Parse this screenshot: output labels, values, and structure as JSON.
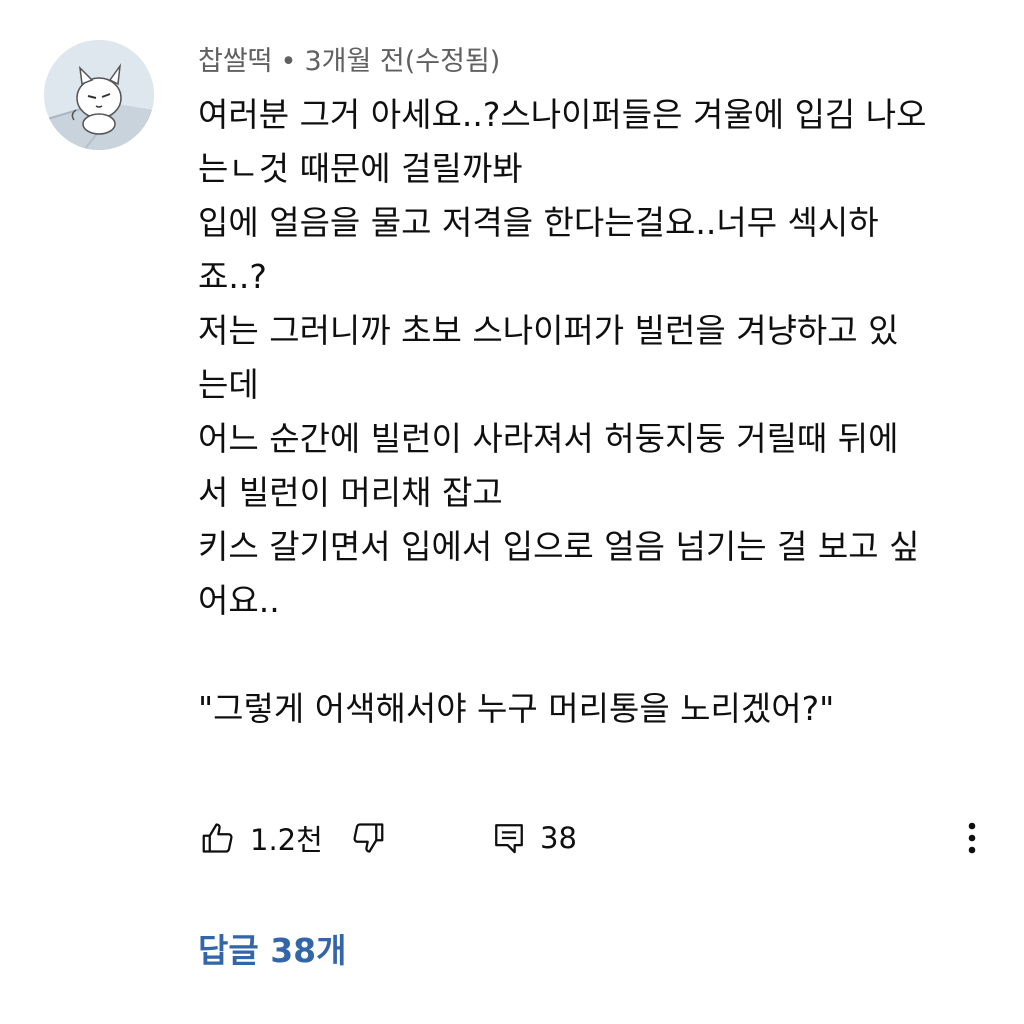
{
  "comment": {
    "author": "찹쌀떡",
    "separator": "•",
    "time": "3개월 전(수정됨)",
    "lines": [
      "여러분 그거 아세요..?스나이퍼들은 겨울에 입김 나오",
      "는ㄴ것 때문에 걸릴까봐",
      "입에 얼음을 물고 저격을 한다는걸요..너무 섹시하",
      "죠..?",
      "저는 그러니까 초보 스나이퍼가 빌런을 겨냥하고 있",
      "는데",
      "어느 순간에 빌런이 사라져서 허둥지둥 거릴때 뒤에",
      "서 빌런이 머리채 잡고",
      "키스 갈기면서 입에서 입으로 얼음 넘기는 걸 보고 싶",
      "어요.."
    ],
    "quote": "\"그렇게 어색해서야 누구 머리통을 노리겠어?\""
  },
  "actions": {
    "like_icon": "thumbs-up-icon",
    "like_count": "1.2천",
    "dislike_icon": "thumbs-down-icon",
    "reply_icon": "comment-icon",
    "reply_count": "38",
    "more_icon": "vertical-dots-icon"
  },
  "replies_link": "답글 38개",
  "colors": {
    "text": "#0f0f0f",
    "meta": "#606060",
    "link": "#3266a8"
  }
}
